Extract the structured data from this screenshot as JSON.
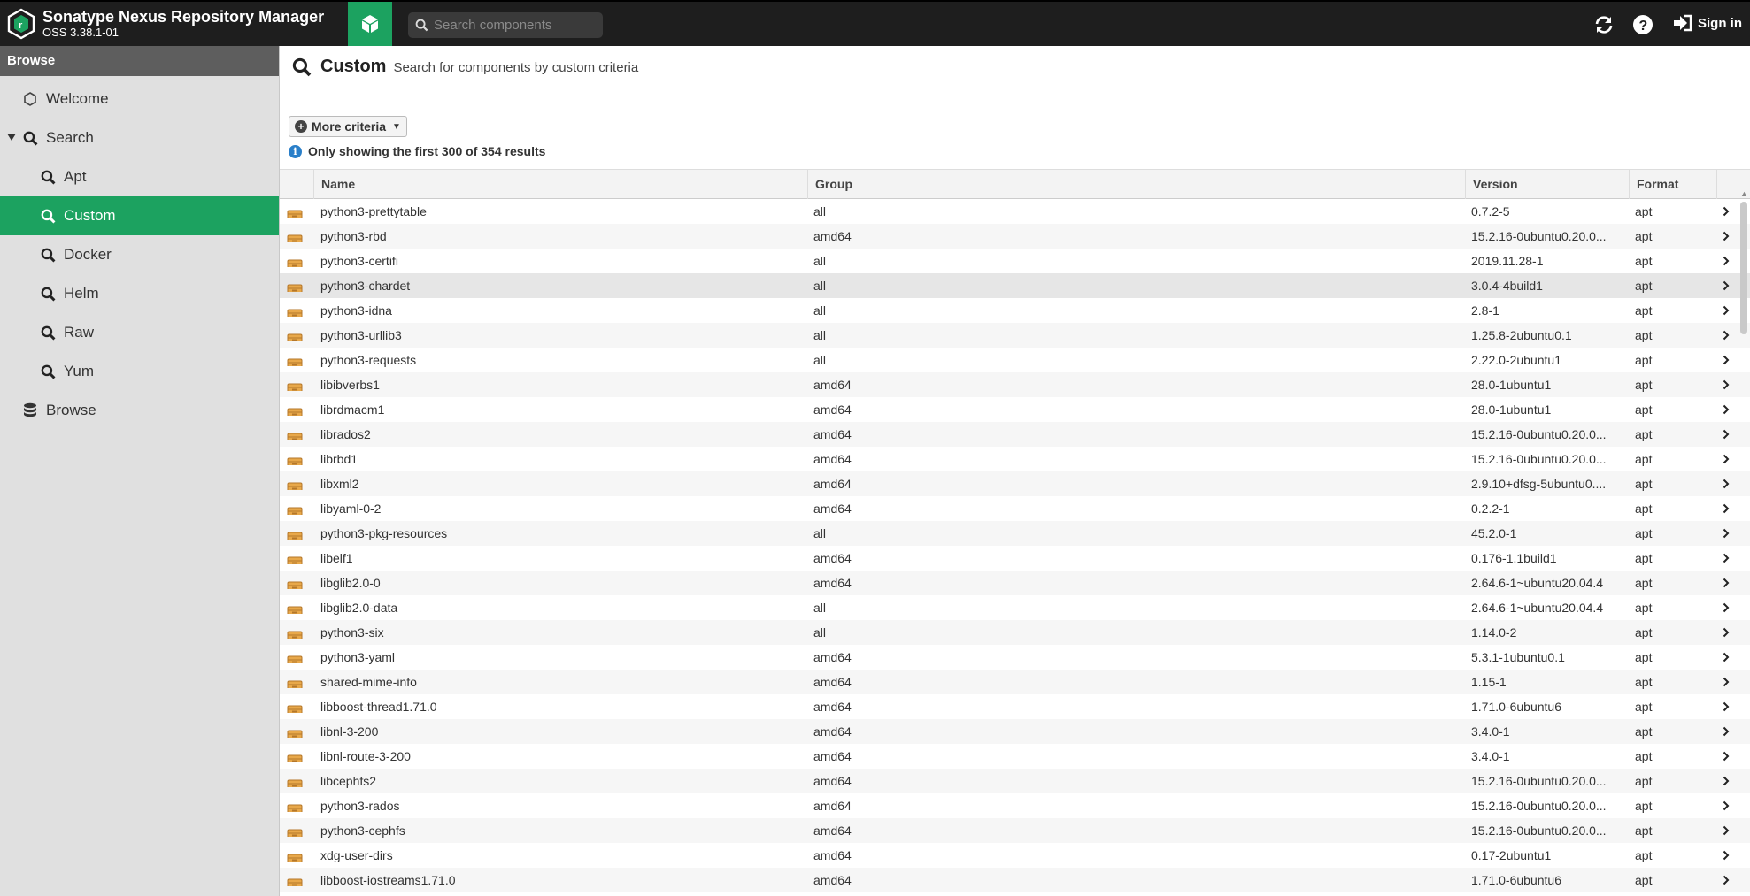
{
  "header": {
    "app_name": "Sonatype Nexus Repository Manager",
    "version": "OSS 3.38.1-01",
    "search_placeholder": "Search components",
    "signin_label": "Sign in",
    "brand_color": "#1ca260"
  },
  "sidebar": {
    "title": "Browse",
    "items": [
      {
        "label": "Welcome",
        "icon": "hexagon-icon"
      },
      {
        "label": "Search",
        "icon": "search-icon"
      },
      {
        "label": "Apt",
        "icon": "search-icon"
      },
      {
        "label": "Custom",
        "icon": "search-icon",
        "active": true
      },
      {
        "label": "Docker",
        "icon": "search-icon"
      },
      {
        "label": "Helm",
        "icon": "search-icon"
      },
      {
        "label": "Raw",
        "icon": "search-icon"
      },
      {
        "label": "Yum",
        "icon": "search-icon"
      },
      {
        "label": "Browse",
        "icon": "database-icon"
      }
    ]
  },
  "main": {
    "title": "Custom",
    "subtitle": "Search for components by custom criteria",
    "more_criteria": "More criteria",
    "info": "Only showing the first 300 of 354 results",
    "columns": [
      "Name",
      "Group",
      "Version",
      "Format"
    ],
    "rows": [
      {
        "name": "python3-prettytable",
        "group": "all",
        "version": "0.7.2-5",
        "format": "apt"
      },
      {
        "name": "python3-rbd",
        "group": "amd64",
        "version": "15.2.16-0ubuntu0.20.0...",
        "format": "apt"
      },
      {
        "name": "python3-certifi",
        "group": "all",
        "version": "2019.11.28-1",
        "format": "apt"
      },
      {
        "name": "python3-chardet",
        "group": "all",
        "version": "3.0.4-4build1",
        "format": "apt"
      },
      {
        "name": "python3-idna",
        "group": "all",
        "version": "2.8-1",
        "format": "apt"
      },
      {
        "name": "python3-urllib3",
        "group": "all",
        "version": "1.25.8-2ubuntu0.1",
        "format": "apt"
      },
      {
        "name": "python3-requests",
        "group": "all",
        "version": "2.22.0-2ubuntu1",
        "format": "apt"
      },
      {
        "name": "libibverbs1",
        "group": "amd64",
        "version": "28.0-1ubuntu1",
        "format": "apt"
      },
      {
        "name": "librdmacm1",
        "group": "amd64",
        "version": "28.0-1ubuntu1",
        "format": "apt"
      },
      {
        "name": "librados2",
        "group": "amd64",
        "version": "15.2.16-0ubuntu0.20.0...",
        "format": "apt"
      },
      {
        "name": "librbd1",
        "group": "amd64",
        "version": "15.2.16-0ubuntu0.20.0...",
        "format": "apt"
      },
      {
        "name": "libxml2",
        "group": "amd64",
        "version": "2.9.10+dfsg-5ubuntu0....",
        "format": "apt"
      },
      {
        "name": "libyaml-0-2",
        "group": "amd64",
        "version": "0.2.2-1",
        "format": "apt"
      },
      {
        "name": "python3-pkg-resources",
        "group": "all",
        "version": "45.2.0-1",
        "format": "apt"
      },
      {
        "name": "libelf1",
        "group": "amd64",
        "version": "0.176-1.1build1",
        "format": "apt"
      },
      {
        "name": "libglib2.0-0",
        "group": "amd64",
        "version": "2.64.6-1~ubuntu20.04.4",
        "format": "apt"
      },
      {
        "name": "libglib2.0-data",
        "group": "all",
        "version": "2.64.6-1~ubuntu20.04.4",
        "format": "apt"
      },
      {
        "name": "python3-six",
        "group": "all",
        "version": "1.14.0-2",
        "format": "apt"
      },
      {
        "name": "python3-yaml",
        "group": "amd64",
        "version": "5.3.1-1ubuntu0.1",
        "format": "apt"
      },
      {
        "name": "shared-mime-info",
        "group": "amd64",
        "version": "1.15-1",
        "format": "apt"
      },
      {
        "name": "libboost-thread1.71.0",
        "group": "amd64",
        "version": "1.71.0-6ubuntu6",
        "format": "apt"
      },
      {
        "name": "libnl-3-200",
        "group": "amd64",
        "version": "3.4.0-1",
        "format": "apt"
      },
      {
        "name": "libnl-route-3-200",
        "group": "amd64",
        "version": "3.4.0-1",
        "format": "apt"
      },
      {
        "name": "libcephfs2",
        "group": "amd64",
        "version": "15.2.16-0ubuntu0.20.0...",
        "format": "apt"
      },
      {
        "name": "python3-rados",
        "group": "amd64",
        "version": "15.2.16-0ubuntu0.20.0...",
        "format": "apt"
      },
      {
        "name": "python3-cephfs",
        "group": "amd64",
        "version": "15.2.16-0ubuntu0.20.0...",
        "format": "apt"
      },
      {
        "name": "xdg-user-dirs",
        "group": "amd64",
        "version": "0.17-2ubuntu1",
        "format": "apt"
      },
      {
        "name": "libboost-iostreams1.71.0",
        "group": "amd64",
        "version": "1.71.0-6ubuntu6",
        "format": "apt"
      }
    ]
  }
}
